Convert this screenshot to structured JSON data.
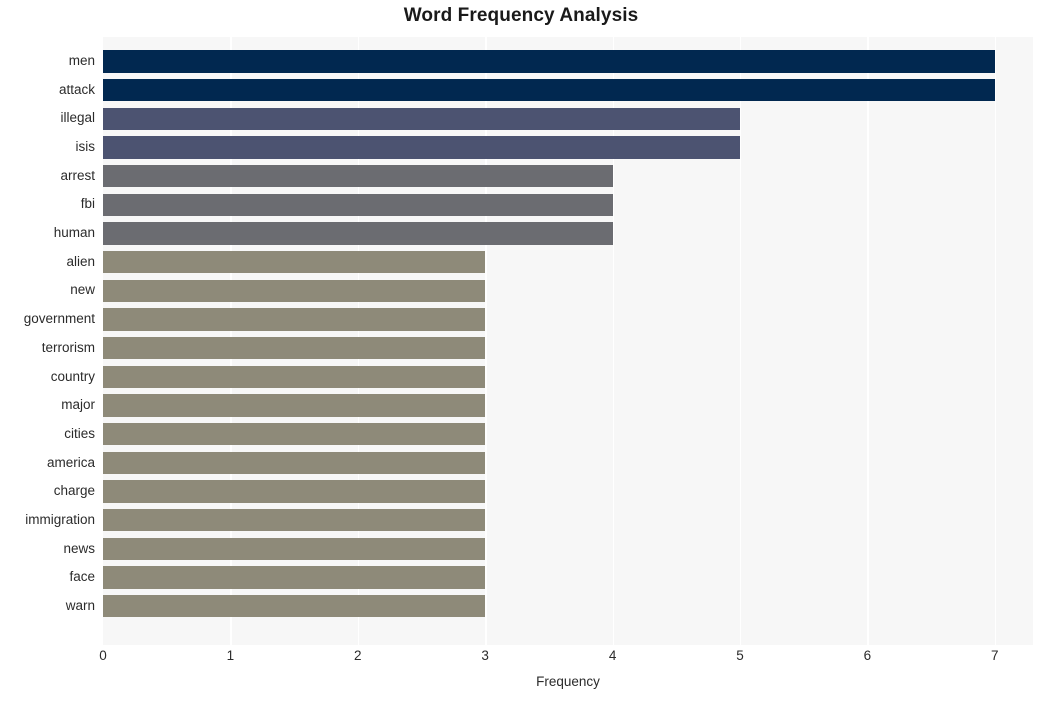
{
  "chart_data": {
    "type": "bar",
    "orientation": "horizontal",
    "title": "Word Frequency Analysis",
    "xlabel": "Frequency",
    "ylabel": "",
    "categories": [
      "men",
      "attack",
      "illegal",
      "isis",
      "arrest",
      "fbi",
      "human",
      "alien",
      "new",
      "government",
      "terrorism",
      "country",
      "major",
      "cities",
      "america",
      "charge",
      "immigration",
      "news",
      "face",
      "warn"
    ],
    "values": [
      7,
      7,
      5,
      5,
      4,
      4,
      4,
      3,
      3,
      3,
      3,
      3,
      3,
      3,
      3,
      3,
      3,
      3,
      3,
      3
    ],
    "bar_colors": [
      "#012850",
      "#012850",
      "#4c5371",
      "#4c5371",
      "#6b6c71",
      "#6b6c71",
      "#6b6c71",
      "#8e8a79",
      "#8e8a79",
      "#8e8a79",
      "#8e8a79",
      "#8e8a79",
      "#8e8a79",
      "#8e8a79",
      "#8e8a79",
      "#8e8a79",
      "#8e8a79",
      "#8e8a79",
      "#8e8a79",
      "#8e8a79"
    ],
    "xlim": [
      0,
      7.3
    ],
    "xticks": [
      0,
      1,
      2,
      3,
      4,
      5,
      6,
      7
    ],
    "xtick_labels": [
      "0",
      "1",
      "2",
      "3",
      "4",
      "5",
      "6",
      "7"
    ],
    "grid": true,
    "grid_axis": "x",
    "grid_color": "#ffffff",
    "plot_background": "#f7f7f7",
    "figure_background": "#ffffff",
    "legend": null
  }
}
